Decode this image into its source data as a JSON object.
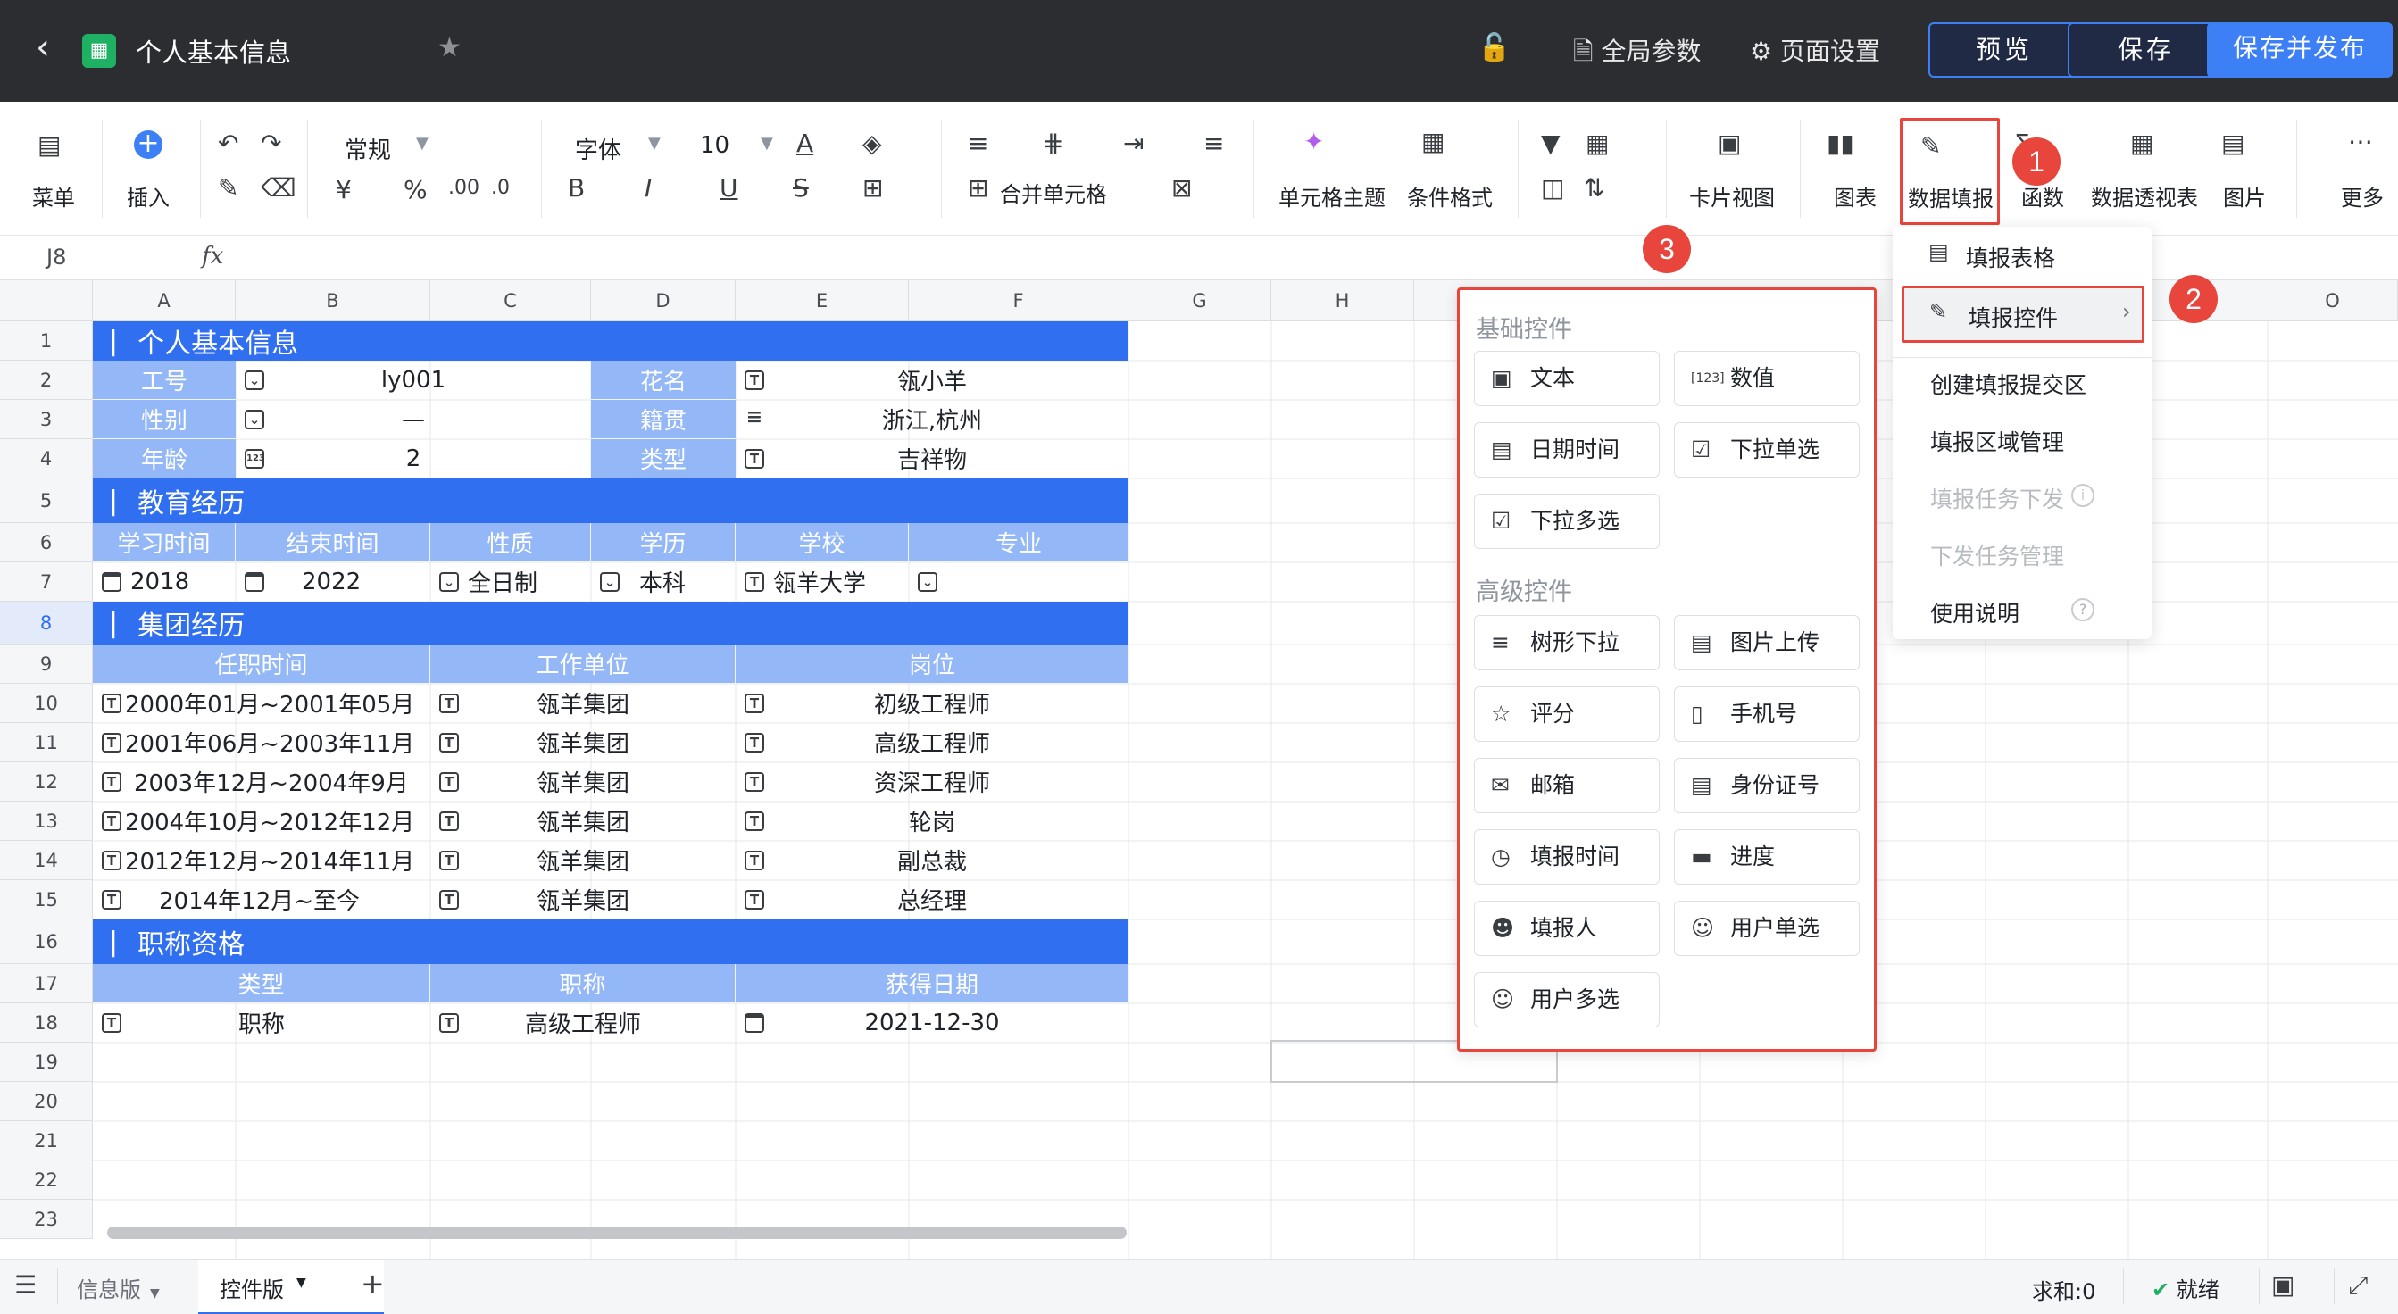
{
  "titlebar": {
    "doc_title": "个人基本信息",
    "global_params": "全局参数",
    "page_settings": "页面设置",
    "preview": "预览",
    "save": "保存",
    "save_publish": "保存并发布"
  },
  "toolbar": {
    "menu": "菜单",
    "insert": "插入",
    "number_format": "常规",
    "font": "字体",
    "font_size": "10",
    "merge_cells": "合并单元格",
    "cell_theme": "单元格主题",
    "cond_format": "条件格式",
    "card_view": "卡片视图",
    "chart": "图表",
    "data_fill": "数据填报",
    "function": "函数",
    "pivot": "数据透视表",
    "image": "图片",
    "more": "更多"
  },
  "formula_bar": {
    "cell_ref": "J8",
    "fx": "fx"
  },
  "columns": [
    "A",
    "B",
    "C",
    "D",
    "E",
    "F",
    "G",
    "H",
    "O"
  ],
  "rows": [
    "1",
    "2",
    "3",
    "4",
    "5",
    "6",
    "7",
    "8",
    "9",
    "10",
    "11",
    "12",
    "13",
    "14",
    "15",
    "16",
    "17",
    "18",
    "19",
    "20",
    "21",
    "22",
    "23"
  ],
  "sheet": {
    "s1": "个人基本信息",
    "r2": {
      "a": "工号",
      "b": "ly001",
      "d": "花名",
      "e": "瓴小羊"
    },
    "r3": {
      "a": "性别",
      "b": "—",
      "d": "籍贯",
      "e": "浙江,杭州"
    },
    "r4": {
      "a": "年龄",
      "b": "2",
      "d": "类型",
      "e": "吉祥物"
    },
    "s5": "教育经历",
    "r6": [
      "学习时间",
      "结束时间",
      "性质",
      "学历",
      "学校",
      "专业"
    ],
    "r7": {
      "a": "2018",
      "b": "2022",
      "c": "全日制",
      "d": "本科",
      "e": "瓴羊大学"
    },
    "s8": "集团经历",
    "r9": [
      "任职时间",
      "工作单位",
      "岗位"
    ],
    "jobs": [
      [
        "2000年01月~2001年05月",
        "瓴羊集团",
        "初级工程师"
      ],
      [
        "2001年06月~2003年11月",
        "瓴羊集团",
        "高级工程师"
      ],
      [
        "2003年12月~2004年9月",
        "瓴羊集团",
        "资深工程师"
      ],
      [
        "2004年10月~2012年12月",
        "瓴羊集团",
        "轮岗"
      ],
      [
        "2012年12月~2014年11月",
        "瓴羊集团",
        "副总裁"
      ],
      [
        "2014年12月~至今",
        "瓴羊集团",
        "总经理"
      ]
    ],
    "s16": "职称资格",
    "r17": [
      "类型",
      "职称",
      "获得日期"
    ],
    "r18": [
      "职称",
      "高级工程师",
      "2021-12-30"
    ]
  },
  "panel": {
    "basic_title": "基础控件",
    "basic": [
      "文本",
      "数值",
      "日期时间",
      "下拉单选",
      "下拉多选"
    ],
    "adv_title": "高级控件",
    "advanced": [
      "树形下拉",
      "图片上传",
      "评分",
      "手机号",
      "邮箱",
      "身份证号",
      "填报时间",
      "进度",
      "填报人",
      "用户单选",
      "用户多选"
    ]
  },
  "menu": {
    "items": [
      "填报表格",
      "填报控件",
      "创建填报提交区",
      "填报区域管理",
      "填报任务下发",
      "下发任务管理",
      "使用说明"
    ]
  },
  "badges": [
    "1",
    "2",
    "3"
  ],
  "bottom": {
    "tab1": "信息版",
    "tab2": "控件版",
    "sum": "求和:0",
    "status": "就绪"
  },
  "colors": {
    "section_blue": "#2f6ff0",
    "header_blue": "#94b8f7",
    "accent_red": "#e8453c",
    "primary": "#3d7ff5"
  }
}
